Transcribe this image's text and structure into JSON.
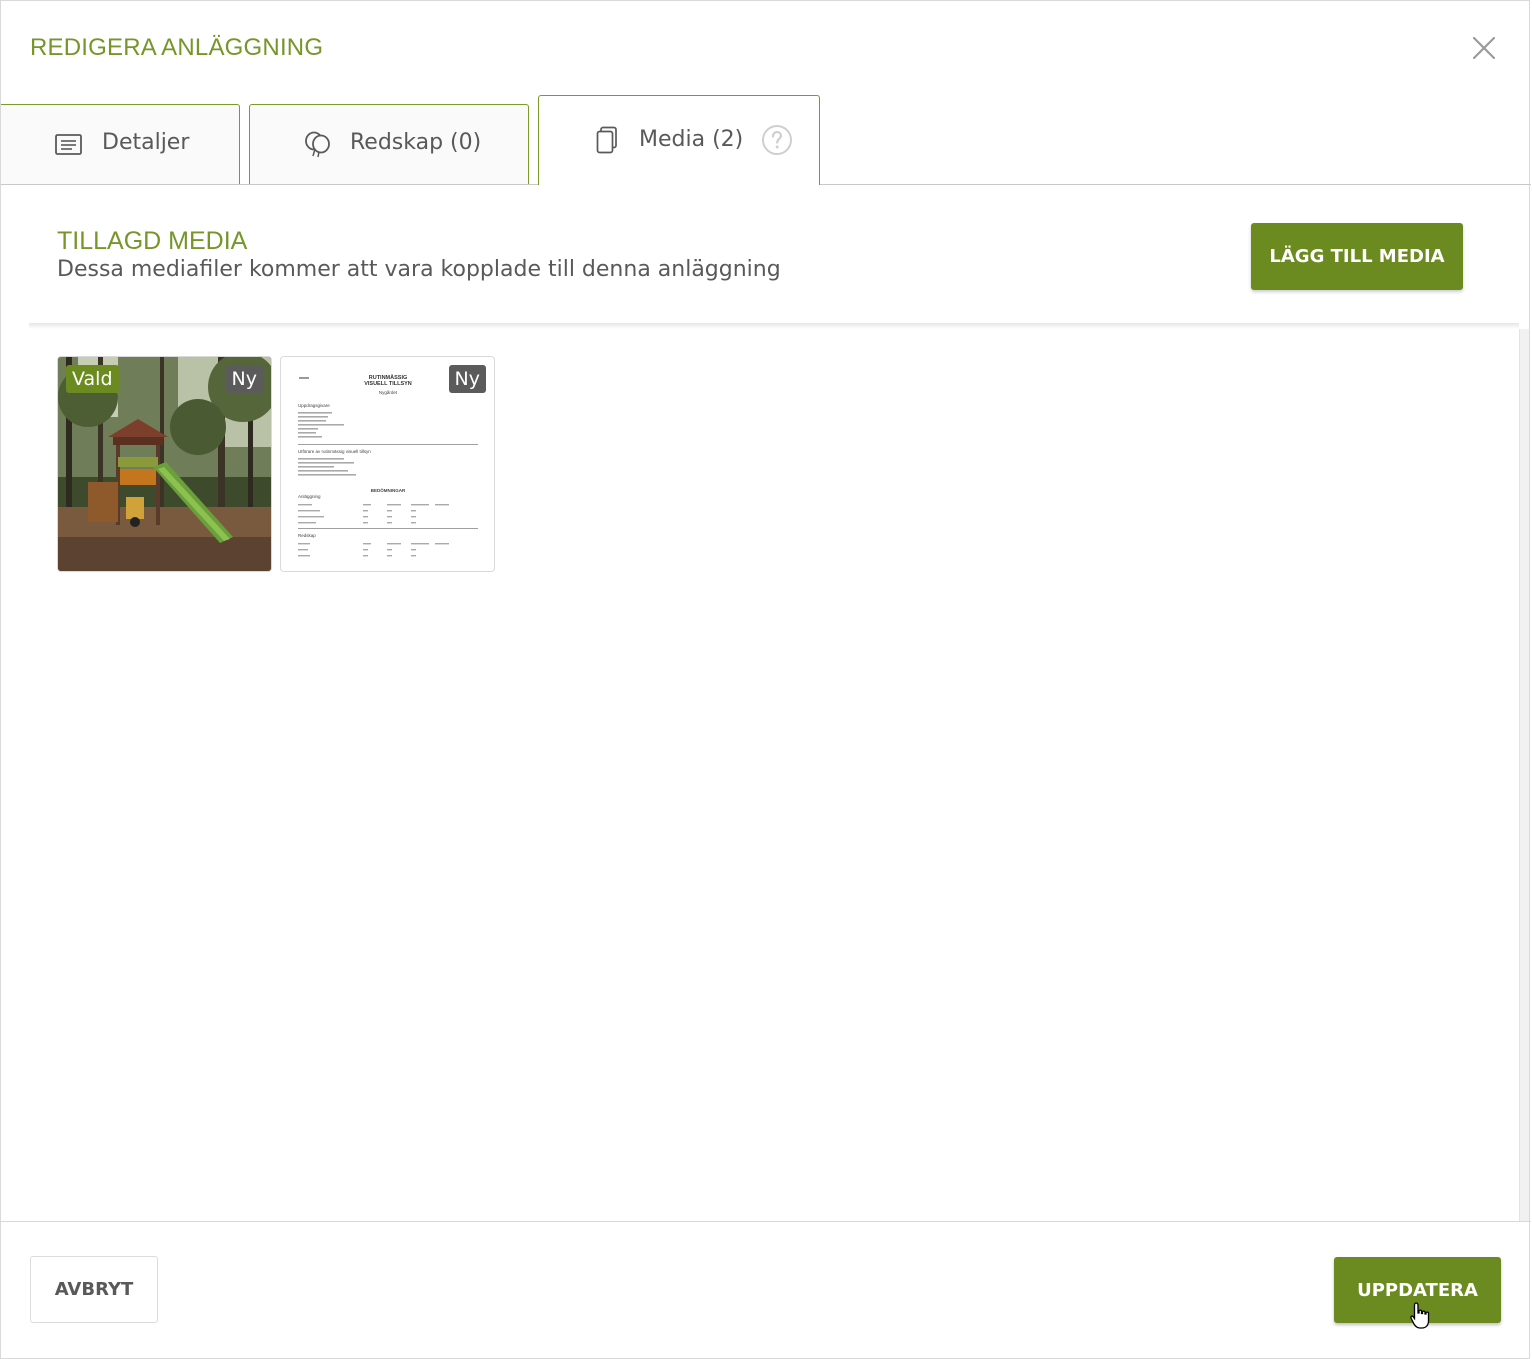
{
  "modal": {
    "title": "REDIGERA ANLÄGGNING",
    "close_icon": "close-icon"
  },
  "tabs": [
    {
      "label": "Detaljer",
      "icon": "list-icon",
      "active": false
    },
    {
      "label": "Redskap (0)",
      "icon": "balloons-icon",
      "active": false
    },
    {
      "label": "Media (2)",
      "icon": "documents-icon",
      "active": true,
      "help_icon": "help-circle-icon"
    }
  ],
  "media_section": {
    "title": "TILLAGD MEDIA",
    "subtitle": "Dessa mediafiler kommer att vara kopplade till denna anläggning",
    "add_button": "LÄGG TILL MEDIA",
    "items": [
      {
        "type": "photo",
        "selected_badge": "Vald",
        "new_badge": "Ny"
      },
      {
        "type": "document",
        "new_badge": "Ny",
        "doc_title_line1": "RUTINMÄSSIG",
        "doc_title_line2": "VISUELL TILLSYN",
        "doc_subtitle": "Nygårdet",
        "doc_section1": "Uppdragsgivare",
        "doc_section2": "Utförare av rutinmässig visuell tillsyn",
        "doc_section3": "BEDÖMNINGAR",
        "doc_section4": "Anläggning",
        "doc_section5": "Redskap"
      }
    ]
  },
  "footer": {
    "cancel_button": "AVBRYT",
    "update_button": "UPPDATERA"
  },
  "colors": {
    "accent": "#76962a",
    "button": "#6b8a1f",
    "badge_new": "#5b5b5b"
  }
}
